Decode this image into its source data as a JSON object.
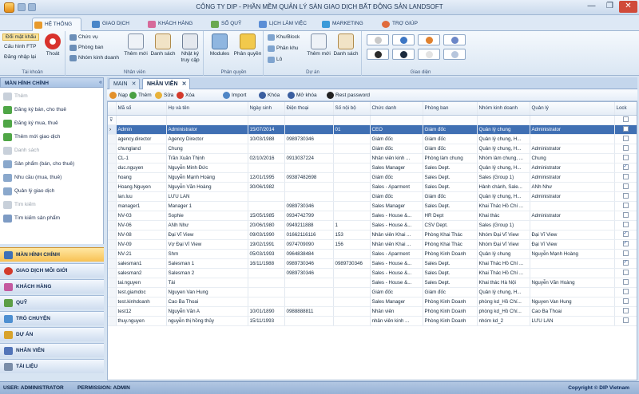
{
  "window": {
    "title": "CÔNG TY DIP - PHẦN MỀM QUẢN LÝ SÀN GIAO DỊCH BẤT ĐỘNG SẢN LANDSOFT",
    "controls": [
      "—",
      "❐",
      "✕"
    ]
  },
  "menu_tabs": [
    "HỆ THỐNG",
    "GIAO DỊCH",
    "KHÁCH HÀNG",
    "SỔ QUỸ",
    "LỊCH LÀM VIỆC",
    "MARKETING",
    "TRỢ GIÚP"
  ],
  "ribbon": {
    "taikhoan": {
      "caption": "Tài khoản",
      "items": [
        "Đổi mật khẩu",
        "Cấu hình FTP",
        "Đăng nhập lại"
      ],
      "logout": "Thoát"
    },
    "nhanvien": {
      "caption": "Nhân viên",
      "items": [
        "Chức vụ",
        "Phòng ban",
        "Nhóm kinh doanh"
      ],
      "big": [
        "Thêm mới",
        "Danh sách",
        "Nhật ký truy cập"
      ]
    },
    "phanquyen": {
      "caption": "Phân quyền",
      "big": [
        "Modules",
        "Phân quyền"
      ]
    },
    "duan": {
      "caption": "Dự án",
      "items": [
        "Khu/Block",
        "Phân khu",
        "Lô"
      ],
      "big": [
        "Thêm mới",
        "Danh sách"
      ]
    },
    "giaodien": {
      "caption": "Giao diện"
    }
  },
  "left": {
    "header": "MÀN HÌNH CHÍNH",
    "collapse": "«",
    "nav": [
      "Thêm",
      "Đăng ký bán, cho thuê",
      "Đăng ký mua, thuê",
      "Thêm mới giao dịch",
      "Danh sách",
      "Sản phẩm (bán, cho thuê)",
      "Nhu cầu (mua, thuê)",
      "Quản lý giao dịch",
      "Tìm kiếm",
      "Tìm kiếm sản phẩm"
    ],
    "sections": [
      "MÀN HÌNH CHÍNH",
      "GIAO DỊCH MÔI GIỚI",
      "KHÁCH HÀNG",
      "QUỸ",
      "TRÒ CHUYỆN",
      "DỰ ÁN",
      "NHÂN VIÊN",
      "TÀI LIỆU"
    ]
  },
  "doc_tabs": [
    "MAIN",
    "NHÂN VIÊN"
  ],
  "toolbar": [
    "Nạp",
    "Thêm",
    "Sửa",
    "Xóa",
    "Import",
    "Khóa",
    "Mở khóa",
    "Rest password"
  ],
  "grid": {
    "columns": [
      "Mã số",
      "Họ và tên",
      "Ngày sinh",
      "Điện thoại",
      "Số nội bộ",
      "Chức danh",
      "Phòng ban",
      "Nhóm kinh doanh",
      "Quản lý",
      "Lock"
    ],
    "rows": [
      [
        "Admin",
        "Administrator",
        "15/07/2014",
        "",
        "01",
        "CEO",
        "Giám đốc",
        "Quản lý chung",
        "Administrator",
        false
      ],
      [
        "agency.director",
        "Agency Director",
        "10/03/1988",
        "0989730346",
        "",
        "Giám đốc",
        "Giám đốc",
        "Quản lý chung, H...",
        "",
        false
      ],
      [
        "chungland",
        "Chung",
        "",
        "",
        "",
        "Giám đốc",
        "Giám đốc",
        "Quản lý chung, H...",
        "Administrator",
        false
      ],
      [
        "CL-1",
        "Trần Xuân Thịnh",
        "02/10/2016",
        "0913037224",
        "",
        "Nhân viên kinh ...",
        "Phòng làm chung",
        "Nhóm làm chung, ...",
        "Chung",
        false
      ],
      [
        "duc.nguyen",
        "Nguyễn Minh Đức",
        "",
        "",
        "",
        "Sales Manager",
        "Sales Dept.",
        "Quản lý chung, H...",
        "Administrator",
        true
      ],
      [
        "hoang",
        "Nguyễn Mạnh Hoàng",
        "12/01/1995",
        "09387482698",
        "",
        "Giám đốc",
        "Sales Dept.",
        "Sales (Group 1)",
        "Administrator",
        false
      ],
      [
        "Hoang.Nguyen",
        "Nguyễn Văn Hoàng",
        "30/06/1982",
        "",
        "",
        "Sales - Aparment",
        "Sales Dept.",
        "Hành chánh, Sale...",
        "ANh Như",
        false
      ],
      [
        "lan.luu",
        "LƯU LAN",
        "",
        "",
        "",
        "Giám đốc",
        "Giám đốc",
        "Quản lý chung, H...",
        "Administrator",
        false
      ],
      [
        "manager1",
        "Manager 1",
        "",
        "0989730346",
        "",
        "Sales Manager",
        "Sales Dept.",
        "Khai Thác Hồ Chí ...",
        "",
        false
      ],
      [
        "NV-03",
        "Sophie",
        "15/05/1985",
        "0934742799",
        "",
        "Sales - House &...",
        "HR Dept",
        "Khai thác",
        "Administrator",
        false
      ],
      [
        "NV-06",
        "ANh Như",
        "20/06/1980",
        "0949211888",
        "1",
        "Sales - House &...",
        "CSV Dept.",
        "Sales (Group 1)",
        "",
        false
      ],
      [
        "NV-08",
        "Đại Vĩ View",
        "09/03/1990",
        "01662116116",
        "153",
        "Nhân viên Khai ...",
        "Phòng Khai Thác",
        "Nhóm Đại Vĩ View",
        "Đại Vĩ View",
        true
      ],
      [
        "NV-09",
        "Vợ Đại Vĩ View",
        "19/02/1991",
        "0974709090",
        "156",
        "Nhân viên Khai ...",
        "Phòng Khai Thác",
        "Nhóm Đại Vĩ View",
        "Đại Vĩ View",
        true
      ],
      [
        "NV-21",
        "Shm",
        "05/03/1993",
        "0964838484",
        "",
        "Sales - Aparment",
        "Phòng Kinh Doanh",
        "Quản lý chung",
        "Nguyễn Mạnh Hoàng",
        false
      ],
      [
        "salesman1",
        "Salesman 1",
        "16/11/1988",
        "0989730346",
        "0989730346",
        "Sales - House &...",
        "Sales Dept.",
        "Khai Thác Hồ Chí ...",
        "",
        true
      ],
      [
        "salesman2",
        "Salesman 2",
        "",
        "0989730346",
        "",
        "Sales - House &...",
        "Sales Dept.",
        "Khai Thác Hồ Chí ...",
        "",
        false
      ],
      [
        "tai.nguyen",
        "Tài",
        "",
        "",
        "",
        "Sales - House &...",
        "Sales Dept.",
        "Khai thác Hà Nội",
        "Nguyễn Văn Hoàng",
        false
      ],
      [
        "test.giamdoc",
        "Nguyen Van Hung",
        "",
        "",
        "",
        "Giám đốc",
        "Giám đốc",
        "Quản lý chung, H...",
        "",
        false
      ],
      [
        "test.kinhdoanh",
        "Cao Ba Thoai",
        "",
        "",
        "",
        "Sales Manager",
        "Phòng Kinh Doanh",
        "phòng kd_Hồ Chí...",
        "Nguyen Van Hung",
        false
      ],
      [
        "test12",
        "Nguyễn Văn A",
        "10/01/1890",
        "0988888811",
        "",
        "Nhân viên",
        "Phòng Kinh Doanh",
        "phòng kd_Hồ Chí...",
        "Cao Ba Thoai",
        false
      ],
      [
        "thuy.nguyen",
        "nguyễn thị hồng thủy",
        "15/11/1993",
        "",
        "",
        "nhân viên kinh ...",
        "Phòng Kinh Doanh",
        "nhóm kd_2",
        "LƯU LAN",
        false
      ]
    ]
  },
  "status": {
    "user": "USER: ADMINISTRATOR",
    "permission": "PERMISSION: ADMIN",
    "copyright": "Copyright © DIP Vietnam"
  }
}
